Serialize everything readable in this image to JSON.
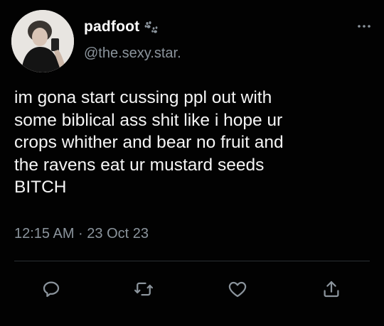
{
  "tweet": {
    "author": {
      "display_name": "padfoot",
      "name_emoji_icon": "paw-prints-icon",
      "handle": "@the.sexy.star."
    },
    "text": "im gona start cussing ppl out with\nsome biblical ass shit like i hope ur\ncrops whither and bear no fruit and\nthe ravens eat ur mustard seeds\nBITCH",
    "timestamp": "12:15 AM · 23 Oct 23",
    "actions": [
      {
        "name": "reply",
        "icon": "reply-icon"
      },
      {
        "name": "retweet",
        "icon": "retweet-icon"
      },
      {
        "name": "like",
        "icon": "heart-icon"
      },
      {
        "name": "share",
        "icon": "share-icon"
      }
    ],
    "colors": {
      "background": "#020202",
      "text": "#f5f5f5",
      "secondary_text": "#8b949c",
      "icon": "#8b949c",
      "divider": "#2a2f33"
    }
  }
}
